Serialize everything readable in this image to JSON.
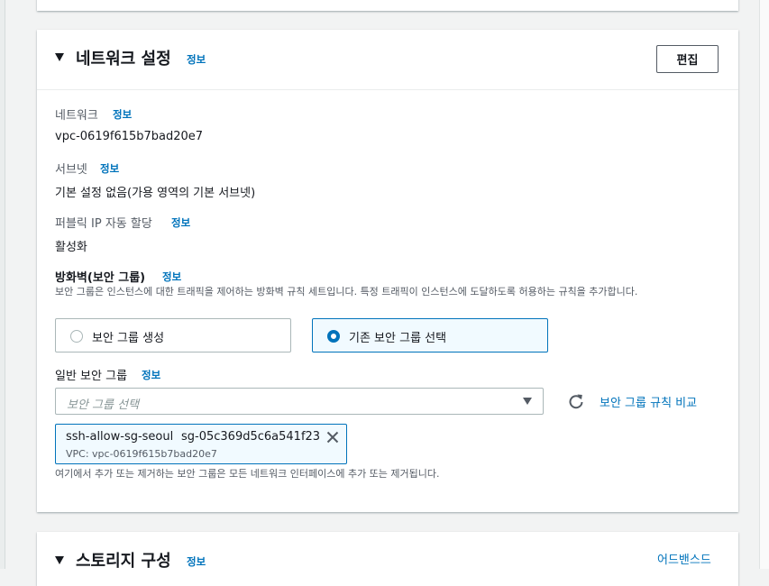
{
  "info_link": "정보",
  "network_settings": {
    "title": "네트워크 설정",
    "edit_button": "편집",
    "network": {
      "label": "네트워크",
      "value": "vpc-0619f615b7bad20e7"
    },
    "subnet": {
      "label": "서브넷",
      "value": "기본 설정 없음(가용 영역의 기본 서브넷)"
    },
    "public_ip": {
      "label": "퍼블릭 IP 자동 할당",
      "value": "활성화"
    },
    "firewall": {
      "label": "방화벽(보안 그룹)",
      "description": "보안 그룹은 인스턴스에 대한 트래픽을 제어하는 방화벽 규칙 세트입니다. 특정 트래픽이 인스턴스에 도달하도록 허용하는 규칙을 추가합니다.",
      "options": [
        {
          "label": "보안 그룹 생성",
          "selected": false
        },
        {
          "label": "기존 보안 그룹 선택",
          "selected": true
        }
      ]
    },
    "common_sg": {
      "label": "일반 보안 그룹",
      "placeholder": "보안 그룹 선택",
      "compare_link": "보안 그룹 규칙 비교",
      "selected": {
        "name": "ssh-allow-sg-seoul",
        "id": "sg-05c369d5c6a541f23",
        "vpc": "VPC: vpc-0619f615b7bad20e7"
      },
      "help": "여기에서 추가 또는 제거하는 보안 그룹은 모든 네트워크 인터페이스에 추가 또는 제거됩니다."
    }
  },
  "storage": {
    "title": "스토리지 구성",
    "advanced_link": "어드밴스드"
  },
  "colors": {
    "link": "#0073bb",
    "selected_bg": "#f1faff",
    "text": "#16191f",
    "secondary": "#545b64"
  }
}
